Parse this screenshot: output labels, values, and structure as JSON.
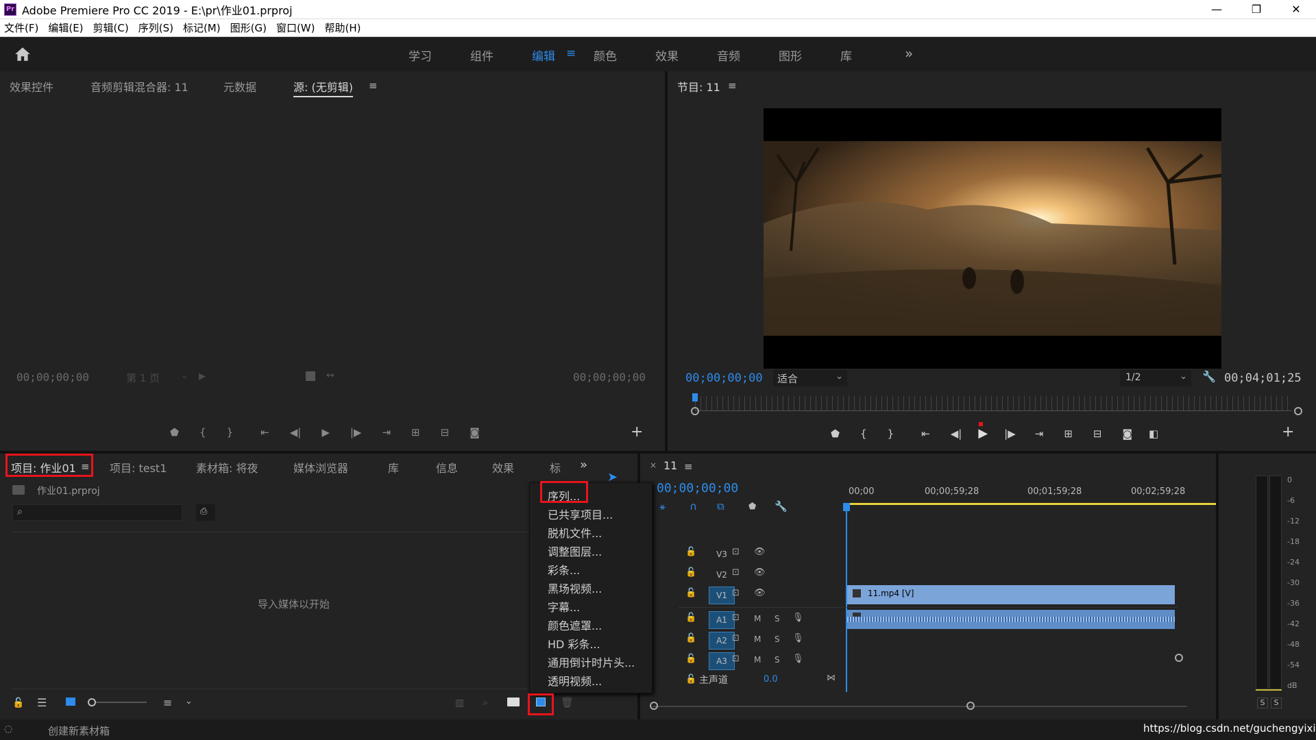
{
  "window": {
    "title": "Adobe Premiere Pro CC 2019 - E:\\pr\\作业01.prproj",
    "app_icon": "Pr",
    "controls": [
      "—",
      "❐",
      "✕"
    ]
  },
  "menubar": [
    "文件(F)",
    "编辑(E)",
    "剪辑(C)",
    "序列(S)",
    "标记(M)",
    "图形(G)",
    "窗口(W)",
    "帮助(H)"
  ],
  "workspaces": {
    "tabs": [
      "学习",
      "组件",
      "编辑",
      "颜色",
      "效果",
      "音频",
      "图形",
      "库"
    ],
    "active": "编辑",
    "more": "»"
  },
  "source_panel": {
    "tabs": [
      "效果控件",
      "音频剪辑混合器: 11",
      "元数据",
      "源: (无剪辑)"
    ],
    "active_tab": "源: (无剪辑)",
    "timecode_in": "00;00;00;00",
    "page_select": "第 1 页",
    "timecode_out": "00;00;00;00"
  },
  "program_panel": {
    "title": "节目: 11",
    "timecode": "00;00;00;00",
    "fit": "适合",
    "resolution": "1/2",
    "duration": "00;04;01;25"
  },
  "project_panel": {
    "tabs": [
      "项目: 作业01",
      "项目: test1",
      "素材箱: 将夜",
      "媒体浏览器",
      "库",
      "信息",
      "效果",
      "标"
    ],
    "active_tab": "项目: 作业01",
    "file_name": "作业01.prproj",
    "search_placeholder": "",
    "empty_hint": "导入媒体以开始",
    "more": "»"
  },
  "context_menu": {
    "items": [
      "序列...",
      "已共享项目...",
      "脱机文件...",
      "调整图层...",
      "彩条...",
      "黑场视频...",
      "字幕...",
      "颜色遮罩...",
      "HD 彩条...",
      "通用倒计时片头...",
      "透明视频..."
    ],
    "highlighted": "序列..."
  },
  "timeline": {
    "sequence_name": "11",
    "timecode": "00;00;00;00",
    "ruler": [
      "00;00",
      "00;00;59;28",
      "00;01;59;28",
      "00;02;59;28"
    ],
    "video_tracks": [
      "V3",
      "V2",
      "V1"
    ],
    "audio_tracks": [
      "A1",
      "A2",
      "A3"
    ],
    "master_label": "主声道",
    "master_value": "0.0",
    "video_clip": "11.mp4 [V]",
    "mute_label": "M",
    "solo_label": "S"
  },
  "meter": {
    "scale": [
      "0",
      "-6",
      "-12",
      "-18",
      "-24",
      "-30",
      "-36",
      "-42",
      "-48",
      "-54",
      "dB"
    ],
    "solo_buttons": [
      "S",
      "S"
    ]
  },
  "statusbar": {
    "text": "创建新素材箱",
    "watermark": "https://blog.csdn.net/guchengyixin"
  },
  "colors": {
    "accent": "#2d8ceb",
    "highlight_box": "#e8141c",
    "track_active": "#1c4f78",
    "video_clip": "#7ba4d9",
    "audio_clip": "#5f8dc8"
  }
}
